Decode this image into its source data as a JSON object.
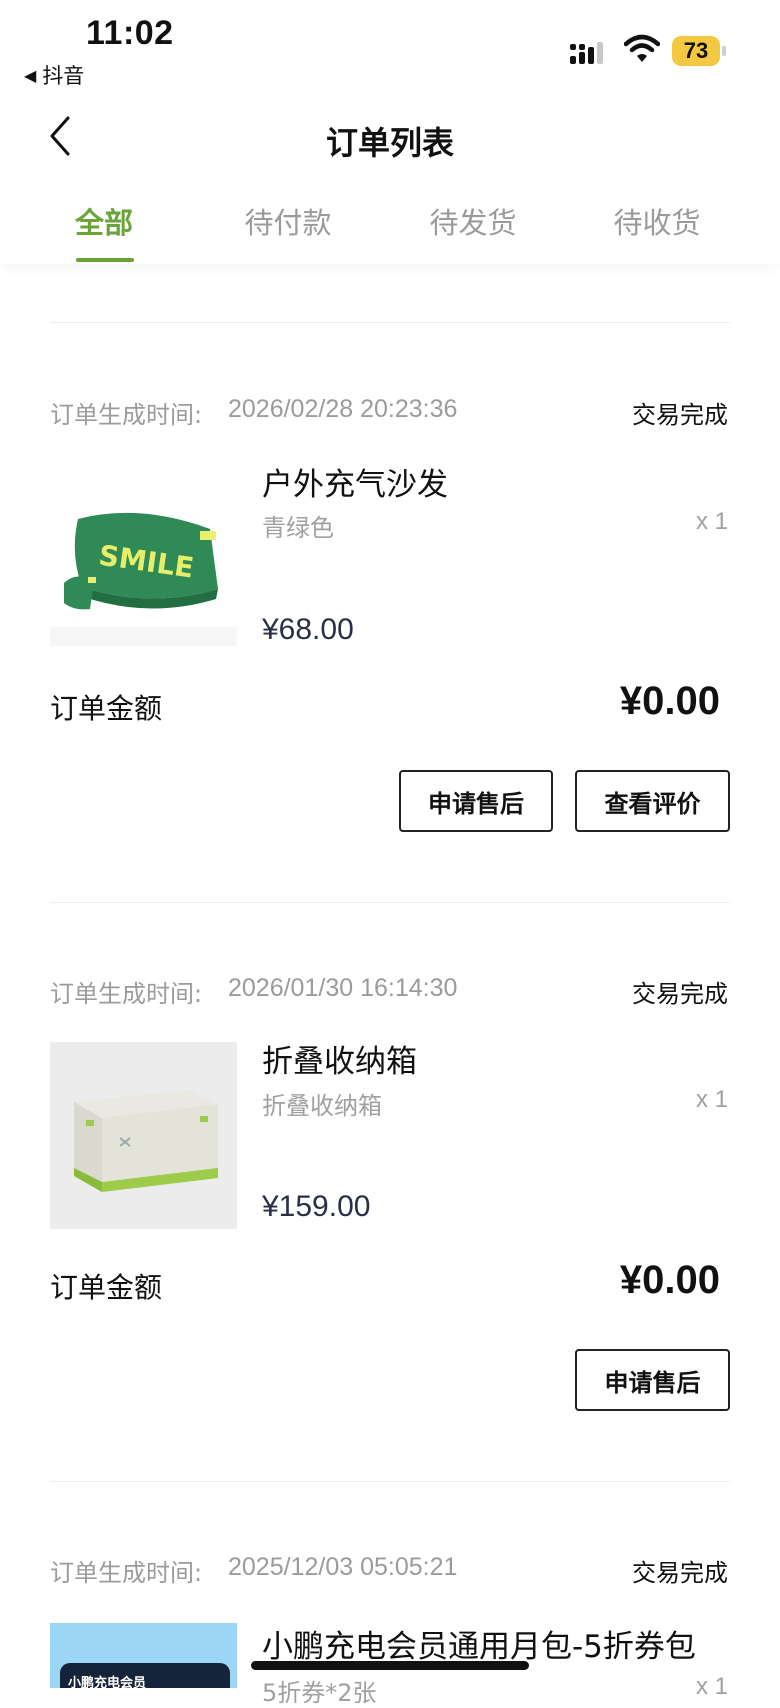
{
  "status_bar": {
    "time": "11:02",
    "back_app": "抖音",
    "battery": "73",
    "icons": [
      "signal-icon",
      "wifi-icon",
      "battery-icon"
    ]
  },
  "nav": {
    "title": "订单列表",
    "back_icon": "chevron-left-icon"
  },
  "tabs": [
    {
      "label": "全部",
      "active": true
    },
    {
      "label": "待付款",
      "active": false
    },
    {
      "label": "待发货",
      "active": false
    },
    {
      "label": "待收货",
      "active": false
    }
  ],
  "orders": [
    {
      "time_label": "订单生成时间:",
      "time": "2026/02/28 20:23:36",
      "status": "交易完成",
      "item_name": "户外充气沙发",
      "variant": "青绿色",
      "qty": "x 1",
      "price": "¥68.00",
      "image_text": "SMILE",
      "total_label": "订单金额",
      "total": "¥0.00",
      "buttons": [
        "申请售后",
        "查看评价"
      ]
    },
    {
      "time_label": "订单生成时间:",
      "time": "2026/01/30 16:14:30",
      "status": "交易完成",
      "item_name": "折叠收纳箱",
      "variant": "折叠收纳箱",
      "qty": "x 1",
      "price": "¥159.00",
      "total_label": "订单金额",
      "total": "¥0.00",
      "buttons": [
        "申请售后"
      ]
    },
    {
      "time_label": "订单生成时间:",
      "time": "2025/12/03 05:05:21",
      "status": "交易完成",
      "item_name": "小鹏充电会员通用月包-5折券包",
      "variant": "5折券*2张",
      "qty": "x 1",
      "image_text": "小鹏充电会员"
    }
  ],
  "colors": {
    "accent": "#6aa437",
    "muted_text": "#9b9b9b",
    "price_text": "#2a2f45",
    "battery": "#f5c842"
  }
}
